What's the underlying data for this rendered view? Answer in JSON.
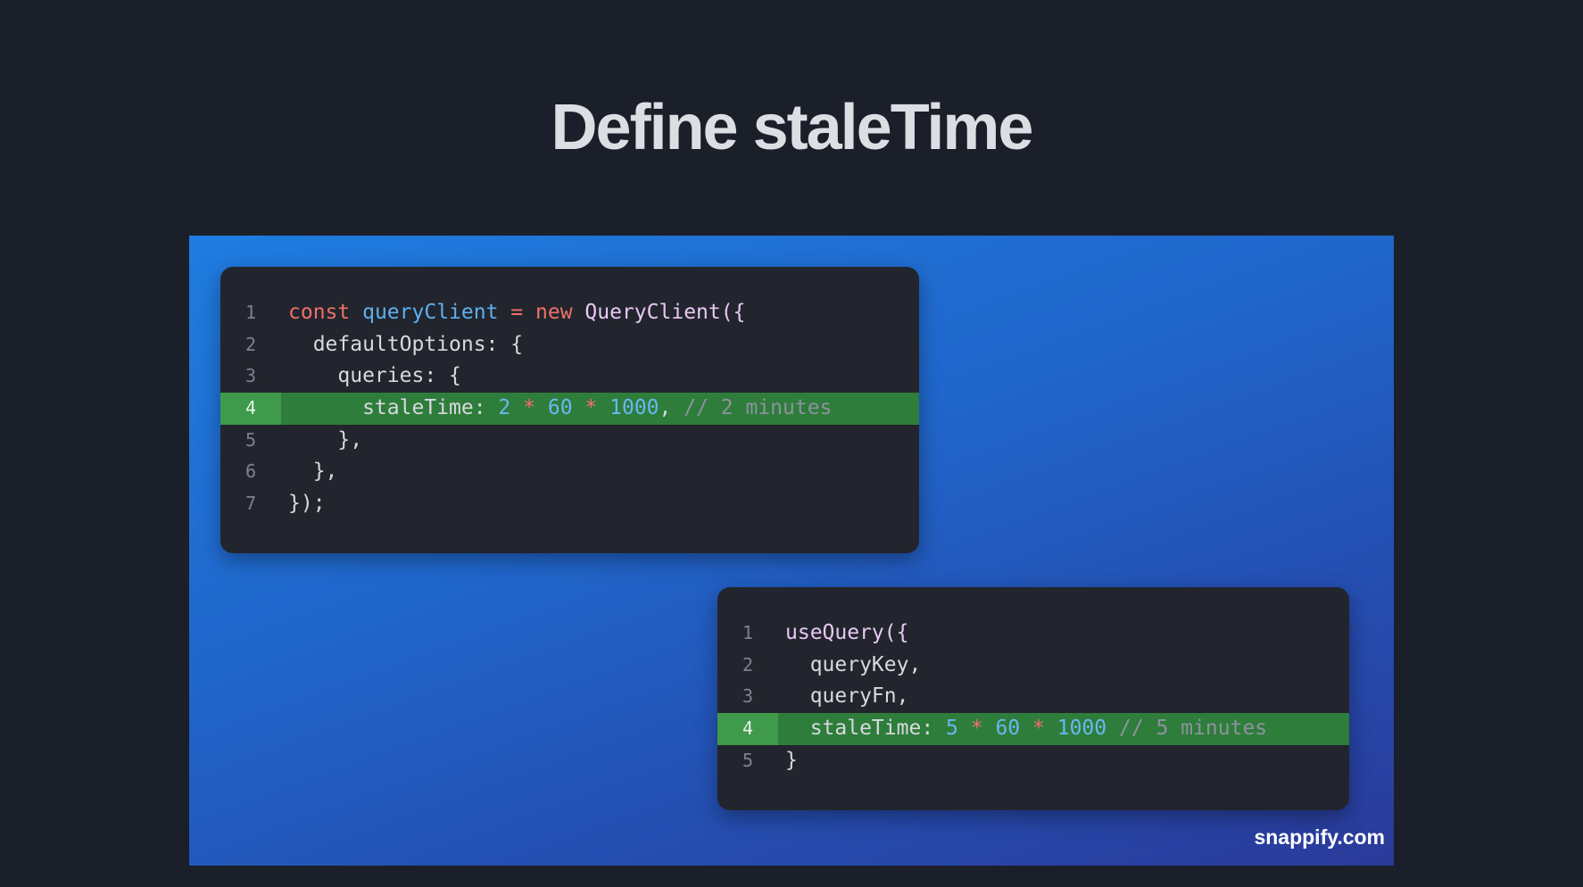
{
  "slide": {
    "title": "Define staleTime"
  },
  "snippet_a": {
    "lines": [
      {
        "num": "1",
        "tokens": [
          "const",
          " ",
          "queryClient",
          " ",
          "=",
          " ",
          "new",
          " ",
          "QueryClient({"
        ]
      },
      {
        "num": "2",
        "tokens": [
          "  defaultOptions: {"
        ]
      },
      {
        "num": "3",
        "tokens": [
          "    queries: {"
        ]
      },
      {
        "num": "4",
        "tokens": [
          "      staleTime: ",
          "2",
          " ",
          "*",
          " ",
          "60",
          " ",
          "*",
          " ",
          "1000",
          ",",
          " ",
          "// 2 minutes"
        ]
      },
      {
        "num": "5",
        "tokens": [
          "    },"
        ]
      },
      {
        "num": "6",
        "tokens": [
          "  },"
        ]
      },
      {
        "num": "7",
        "tokens": [
          "});"
        ]
      }
    ]
  },
  "snippet_b": {
    "lines": [
      {
        "num": "1",
        "tokens": [
          "useQuery({"
        ]
      },
      {
        "num": "2",
        "tokens": [
          "  queryKey,"
        ]
      },
      {
        "num": "3",
        "tokens": [
          "  queryFn,"
        ]
      },
      {
        "num": "4",
        "tokens": [
          "  staleTime: ",
          "5",
          " ",
          "*",
          " ",
          "60",
          " ",
          "*",
          " ",
          "1000",
          " ",
          "// 5 minutes"
        ]
      },
      {
        "num": "5",
        "tokens": [
          "}"
        ]
      }
    ]
  },
  "watermark": "snappify.com",
  "colors": {
    "background": "#1b1f29",
    "highlight_line": "#2e7d3b",
    "keyword": "#f0706a",
    "number": "#68b8f2",
    "comment": "#8d939d"
  }
}
